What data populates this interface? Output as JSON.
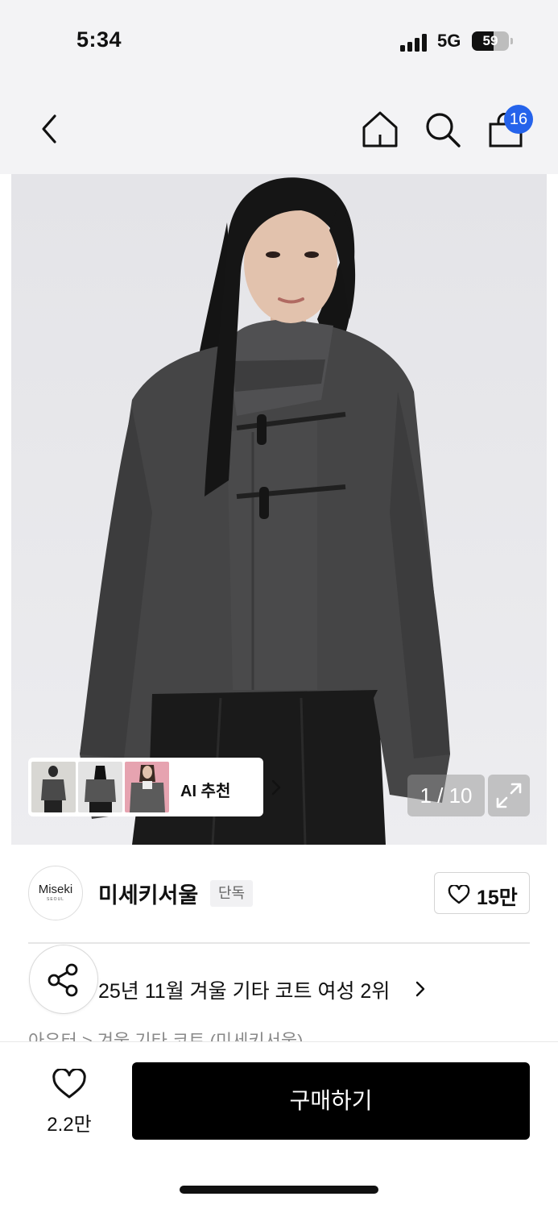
{
  "status_bar": {
    "time": "5:34",
    "network": "5G",
    "battery": "59",
    "battery_level": 0.59
  },
  "nav": {
    "cart_badge": "16"
  },
  "ai_recommend": {
    "label": "AI 추천"
  },
  "pager": {
    "text": "1 / 10"
  },
  "brand": {
    "logo_line1": "Miseki",
    "logo_line2": "SEOUL",
    "name": "미세키서울",
    "exclusive_badge": "단독",
    "likes": "15만"
  },
  "ranking": {
    "text": "25년 11월 겨울 기타 코트 여성 2위"
  },
  "breadcrumb": "아우터  >  겨울 기타 코트 (미세키서울)",
  "bottom": {
    "wish_count": "2.2만",
    "buy_label": "구매하기"
  },
  "icons": {
    "back": "chevron-left-icon",
    "home": "home-icon",
    "search": "search-icon",
    "cart": "shopping-bag-icon",
    "expand": "expand-icon",
    "share": "share-icon",
    "heart": "heart-icon"
  },
  "colors": {
    "badge": "#2563eb",
    "buy_button": "#000000"
  }
}
